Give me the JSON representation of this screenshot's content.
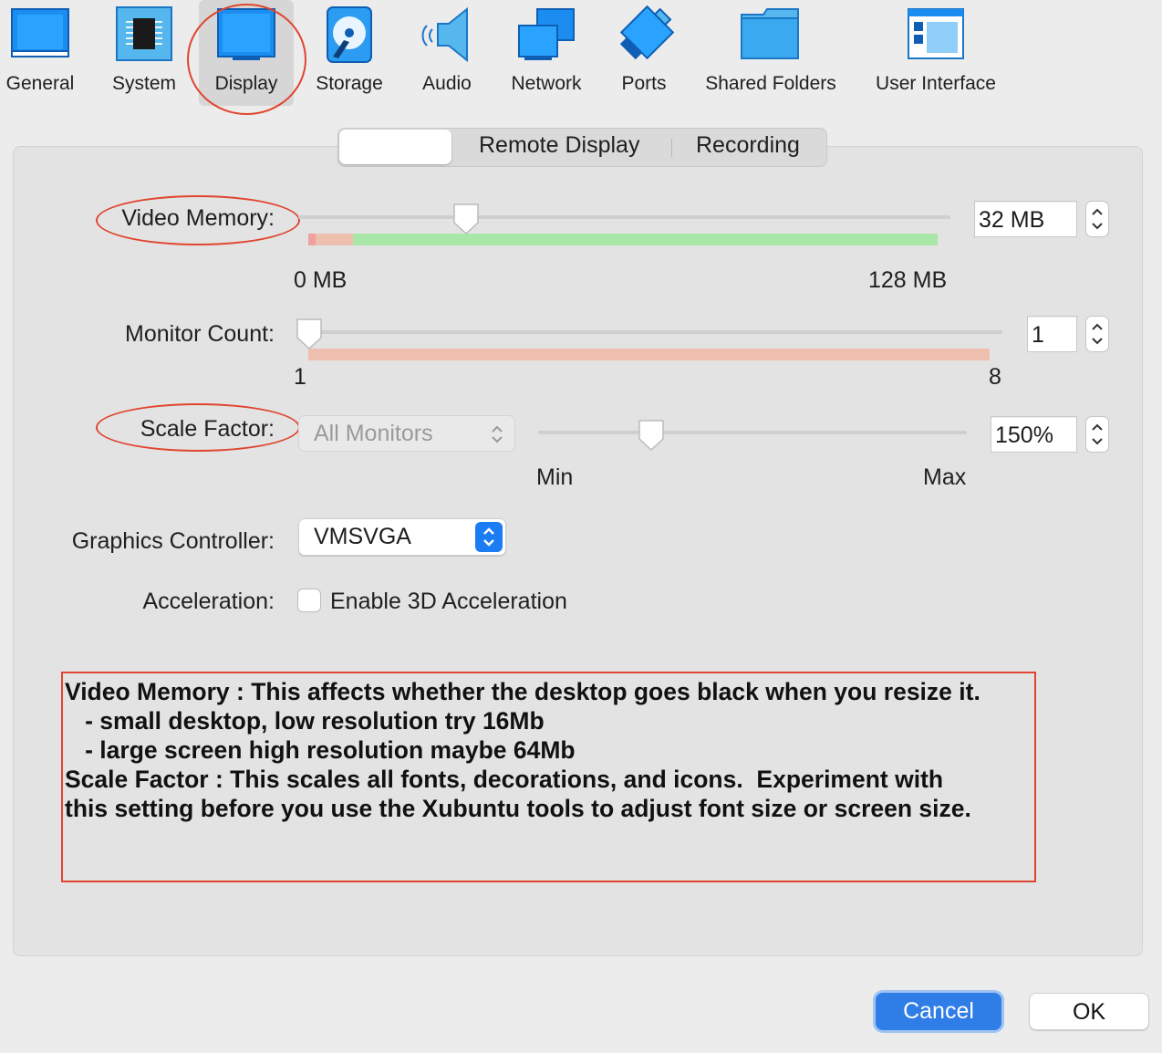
{
  "toolbar": {
    "items": [
      {
        "label": "General",
        "icon": "general-icon"
      },
      {
        "label": "System",
        "icon": "system-icon"
      },
      {
        "label": "Display",
        "icon": "display-icon",
        "selected": true
      },
      {
        "label": "Storage",
        "icon": "storage-icon"
      },
      {
        "label": "Audio",
        "icon": "audio-icon"
      },
      {
        "label": "Network",
        "icon": "network-icon"
      },
      {
        "label": "Ports",
        "icon": "ports-icon"
      },
      {
        "label": "Shared Folders",
        "icon": "shared-folders-icon"
      },
      {
        "label": "User Interface",
        "icon": "user-interface-icon"
      }
    ]
  },
  "tabs": {
    "items": [
      {
        "label": "",
        "selected": true
      },
      {
        "label": "Remote Display"
      },
      {
        "label": "Recording"
      }
    ]
  },
  "video_memory": {
    "label": "Video Memory:",
    "value": "32 MB",
    "min_label": "0 MB",
    "max_label": "128 MB",
    "level": 0.25
  },
  "monitor_count": {
    "label": "Monitor Count:",
    "value": "1",
    "min_label": "1",
    "max_label": "8",
    "level": 0
  },
  "scale_factor": {
    "label": "Scale Factor:",
    "monitor_select": "All Monitors",
    "value": "150%",
    "min_label": "Min",
    "max_label": "Max"
  },
  "graphics_controller": {
    "label": "Graphics Controller:",
    "value": "VMSVGA"
  },
  "acceleration": {
    "label": "Acceleration:",
    "checkbox_label": "Enable 3D Acceleration",
    "checked": false
  },
  "note": {
    "lines": [
      "Video Memory : This affects whether the desktop goes black when you resize it.",
      "   - small desktop, low resolution try 16Mb",
      "   - large screen high resolution maybe 64Mb",
      "",
      "Scale Factor : This scales all fonts, decorations, and icons.  Experiment with",
      "this setting before you use the Xubuntu tools to adjust font size or screen size."
    ]
  },
  "buttons": {
    "cancel": "Cancel",
    "ok": "OK"
  },
  "colors": {
    "accent": "#1c7cf4",
    "annotation": "#e0452f",
    "range_ok": "#a9e7a8",
    "range_warn": "#eebfae"
  }
}
